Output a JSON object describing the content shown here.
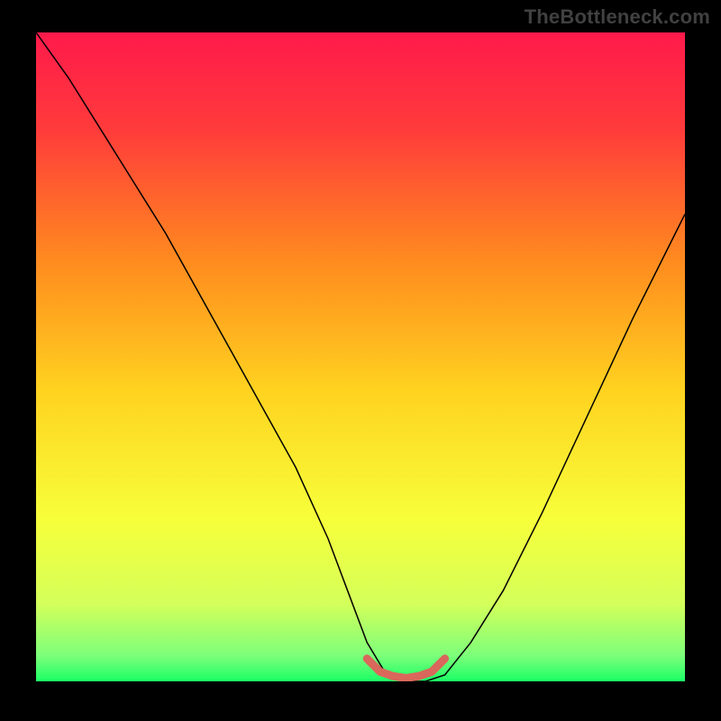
{
  "watermark": "TheBottleneck.com",
  "chart_data": {
    "type": "line",
    "title": "",
    "xlabel": "",
    "ylabel": "",
    "xlim": [
      0,
      100
    ],
    "ylim": [
      0,
      100
    ],
    "background_gradient": {
      "stops": [
        {
          "offset": 0.0,
          "color": "#ff1a4b"
        },
        {
          "offset": 0.15,
          "color": "#ff3b3b"
        },
        {
          "offset": 0.35,
          "color": "#ff8a1f"
        },
        {
          "offset": 0.55,
          "color": "#ffd21f"
        },
        {
          "offset": 0.75,
          "color": "#f7ff3a"
        },
        {
          "offset": 0.88,
          "color": "#d4ff5a"
        },
        {
          "offset": 0.96,
          "color": "#7dff7a"
        },
        {
          "offset": 1.0,
          "color": "#1aff66"
        }
      ]
    },
    "series": [
      {
        "name": "bottleneck-curve",
        "color": "#000000",
        "width": 1.5,
        "x": [
          0,
          5,
          10,
          15,
          20,
          25,
          30,
          35,
          40,
          45,
          48,
          51,
          54,
          57,
          60,
          63,
          67,
          72,
          78,
          85,
          92,
          100
        ],
        "y": [
          100,
          93,
          85,
          77,
          69,
          60,
          51,
          42,
          33,
          22,
          14,
          6,
          1,
          0,
          0,
          1,
          6,
          14,
          26,
          41,
          56,
          72
        ]
      },
      {
        "name": "optimal-zone-marker",
        "color": "#d9675b",
        "width": 9,
        "x": [
          51,
          53,
          55,
          57,
          59,
          61,
          63
        ],
        "y": [
          3.5,
          1.5,
          0.8,
          0.5,
          0.8,
          1.5,
          3.5
        ]
      }
    ]
  }
}
